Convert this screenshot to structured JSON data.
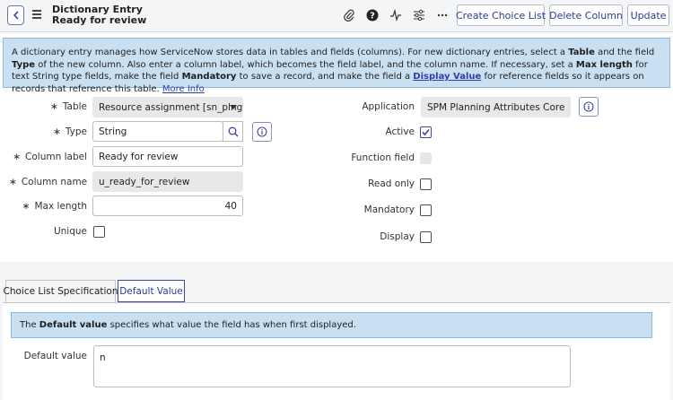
{
  "header": {
    "title_line1": "Dictionary Entry",
    "title_line2": "Ready for review",
    "buttons": {
      "create_choice_list": "Create Choice List",
      "delete_column": "Delete Column",
      "update": "Update"
    },
    "icons": [
      "back-icon",
      "menu-icon",
      "paperclip-icon",
      "help-icon",
      "activity-icon",
      "settings-sliders-icon",
      "more-icon"
    ]
  },
  "banner": {
    "p1": "A dictionary entry manages how ServiceNow stores data in tables and fields (columns). For new dictionary entries, select a ",
    "b_table": "Table",
    "p2": " and the field ",
    "b_type": "Type",
    "p3": " of the new column. Also enter a column label, which becomes the field label, and the column name. If necessary, set a ",
    "b_maxlen": "Max length",
    "p4": " for text String type fields, make the field ",
    "b_mandatory": "Mandatory",
    "p5": " to save a record, and make the field a ",
    "link_display_value": "Display Value",
    "p6": " for reference fields so it appears on records that reference this table. ",
    "link_more_info": "More Info"
  },
  "form": {
    "required_mark": "∗",
    "table": {
      "label": "Table",
      "value": "Resource assignment [sn_plng..."
    },
    "type": {
      "label": "Type",
      "value": "String"
    },
    "column_label": {
      "label": "Column label",
      "value": "Ready for review"
    },
    "column_name": {
      "label": "Column name",
      "value": "u_ready_for_review"
    },
    "max_length": {
      "label": "Max length",
      "value": "40"
    },
    "unique": {
      "label": "Unique",
      "checked": false
    },
    "application": {
      "label": "Application",
      "value": "SPM Planning Attributes Core"
    },
    "active": {
      "label": "Active",
      "checked": true
    },
    "function_field": {
      "label": "Function field",
      "checked": false,
      "disabled": true
    },
    "read_only": {
      "label": "Read only",
      "checked": false
    },
    "mandatory": {
      "label": "Mandatory",
      "checked": false
    },
    "display": {
      "label": "Display",
      "checked": false
    }
  },
  "tabs": {
    "choice_list": "Choice List Specification",
    "default_value": "Default Value"
  },
  "default_panel": {
    "banner_pre": "The ",
    "banner_bold": "Default value",
    "banner_post": " specifies what value the field has when first displayed.",
    "field_label": "Default value",
    "field_value": "n"
  },
  "colors": {
    "accent": "#2b3b8f",
    "banner_bg": "#c9e0f3",
    "header_bg": "#f4f5f7"
  }
}
